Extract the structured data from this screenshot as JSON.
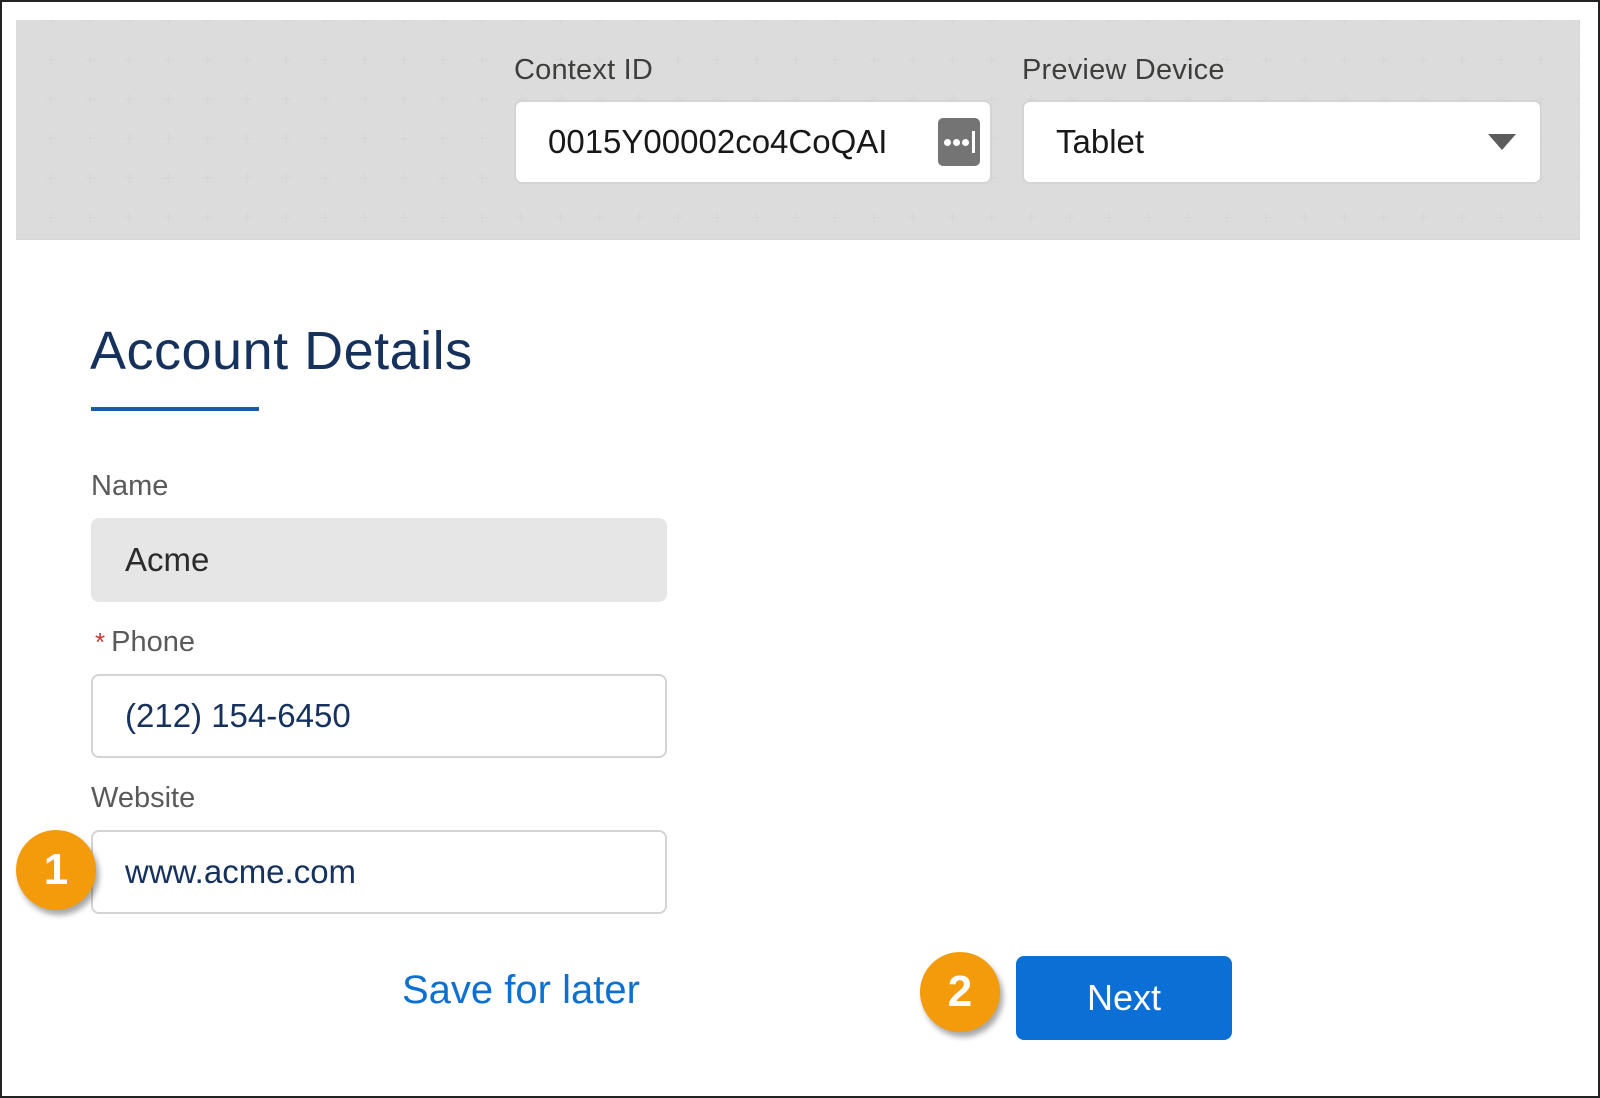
{
  "header": {
    "context_id": {
      "label": "Context ID",
      "value": "0015Y00002co4CoQAI",
      "lookup_icon": "ellipsis-lookup-icon"
    },
    "preview_device": {
      "label": "Preview Device",
      "selected": "Tablet",
      "dropdown_icon": "caret-down-icon"
    }
  },
  "section": {
    "title": "Account Details"
  },
  "form": {
    "fields": [
      {
        "label": "Name",
        "value": "Acme",
        "required": false,
        "readonly": true
      },
      {
        "label": "Phone",
        "value": "(212) 154-6450",
        "required": true,
        "required_marker": "*",
        "readonly": false
      },
      {
        "label": "Website",
        "value": "www.acme.com",
        "required": false,
        "readonly": false
      }
    ]
  },
  "actions": {
    "save_for_later": "Save for later",
    "next": "Next"
  },
  "callouts": [
    {
      "number": "1"
    },
    {
      "number": "2"
    }
  ],
  "colors": {
    "accent": "#0b6fd6",
    "title": "#16325c",
    "callout": "#f49b0b",
    "required": "#c23934"
  }
}
